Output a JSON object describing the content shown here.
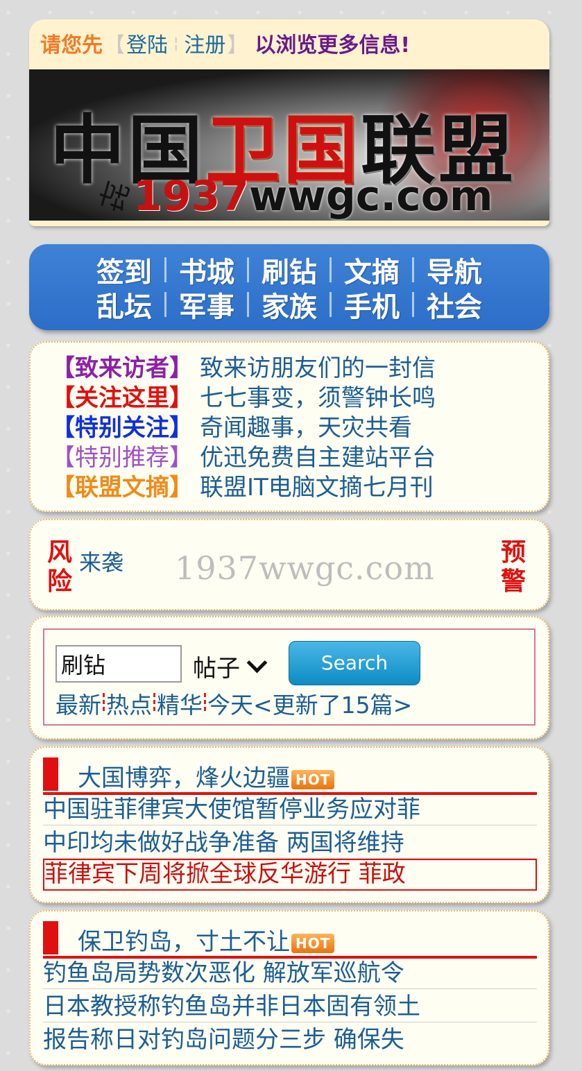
{
  "login": {
    "prefix": "请您先",
    "bracket_open": "【",
    "login_link": "登陆",
    "separator": "¦",
    "register_link": "注册",
    "bracket_close": "】",
    "suffix": "以浏览更多信息!"
  },
  "banner": {
    "title_part1": "中国",
    "title_part2": "卫国",
    "title_part3": "联盟",
    "url_part1": "1937",
    "url_part2": "wwgc.com"
  },
  "nav": {
    "row1": [
      "签到",
      "书城",
      "刷钻",
      "文摘",
      "导航"
    ],
    "row2": [
      "乱坛",
      "军事",
      "家族",
      "手机",
      "社会"
    ]
  },
  "notices": [
    {
      "tag": "【致来访者】",
      "text": "致来访朋友们的一封信",
      "color": "#8e1fa8"
    },
    {
      "tag": "【关注这里】",
      "text": " 七七事变，须警钟长鸣",
      "color": "#e01010"
    },
    {
      "tag": "【特别关注】",
      "text": "奇闻趣事，天灾共看",
      "color": "#1030d8"
    },
    {
      "tag": "【特别推荐】",
      "text": "优迅免费自主建站平台",
      "color": "#a050c8"
    },
    {
      "tag": "【联盟文摘】",
      "text": "联盟IT电脑文摘七月刊",
      "color": "#f08a18"
    }
  ],
  "warning": {
    "left": "风险",
    "sub": "来袭",
    "url": "1937wwgc.com",
    "right": "预警"
  },
  "search": {
    "value": "刷钻",
    "type": "帖子",
    "button": "Search",
    "links": [
      "最新",
      "热点",
      "精华",
      "今天"
    ],
    "update_text": "<更新了15篇>"
  },
  "news1": {
    "title": "大国博弈，烽火边疆",
    "hot": "HOT",
    "items": [
      "中国驻菲律宾大使馆暂停业务应对菲",
      "中印均未做好战争准备 两国将维持",
      "菲律宾下周将掀全球反华游行 菲政"
    ]
  },
  "news2": {
    "title": "保卫钓岛，寸土不让",
    "hot": "HOT",
    "items": [
      "钓鱼岛局势数次恶化 解放军巡航令",
      "日本教授称钓鱼岛并非日本固有领土",
      "报告称日对钓岛问题分三步 确保失"
    ]
  }
}
